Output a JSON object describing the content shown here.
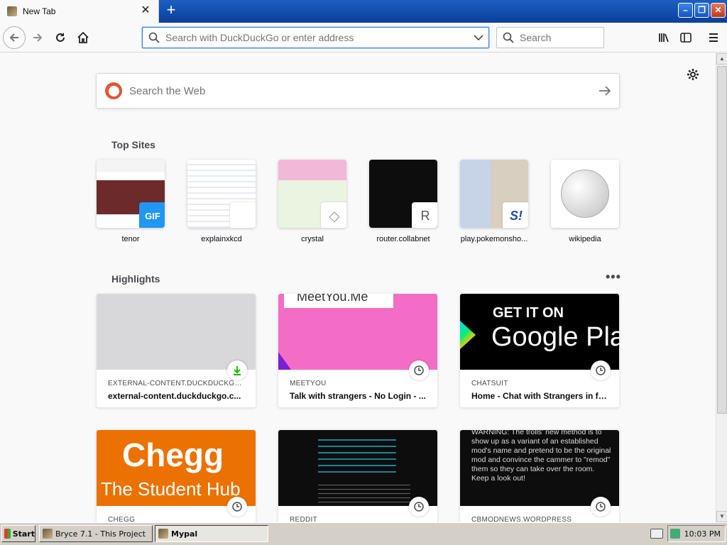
{
  "tab": {
    "title": "New Tab",
    "close": "✕"
  },
  "newtab": "+",
  "window": {
    "min": "–",
    "max": "❐",
    "close": "✕"
  },
  "urlbar": {
    "placeholder": "Search with DuckDuckGo or enter address"
  },
  "searchbar": {
    "placeholder": "Search"
  },
  "websearch": {
    "placeholder": "Search the Web"
  },
  "topsites": {
    "title": "Top Sites",
    "items": [
      {
        "label": "tenor",
        "badge": "GIF"
      },
      {
        "label": "explainxkcd",
        "badge": ""
      },
      {
        "label": "crystal",
        "badge": "◇"
      },
      {
        "label": "router.collabnet",
        "badge": "R"
      },
      {
        "label": "play.pokemonsho...",
        "badge": "S!"
      },
      {
        "label": "wikipedia",
        "badge": ""
      }
    ]
  },
  "highlights": {
    "title": "Highlights",
    "menu": "•••",
    "cards": [
      {
        "context": "EXTERNAL-CONTENT.DUCKDUCKGO — 3...",
        "title": "external-content.duckduckgo.c...",
        "icon": "download-icon"
      },
      {
        "context": "MEETYOU",
        "title": "Talk with strangers - No Login - ...",
        "icon": "clock-icon",
        "img_text": "MeetYou.Me"
      },
      {
        "context": "CHATSUIT",
        "title": "Home - Chat with Strangers in fr...",
        "icon": "clock-icon",
        "img_text_1": "GET IT ON",
        "img_text_2": "Google Pla"
      },
      {
        "context": "CHEGG",
        "title": "",
        "icon": "clock-icon",
        "img_text_1": "Chegg",
        "img_text_2": "The Student Hub"
      },
      {
        "context": "REDDIT",
        "title": "",
        "icon": "clock-icon"
      },
      {
        "context": "CBMODNEWS.WORDPRESS",
        "title": "",
        "icon": "clock-icon",
        "img_text": "WARNING: The trolls' new method is to show up as a variant of an established mod's name and pretend to be the original mod and convince the cammer to \"remod\" them so they can take over the room. Keep a look out!"
      }
    ]
  },
  "taskbar": {
    "start": "Start",
    "tasks": [
      "Bryce 7.1 - This Project",
      "Mypal"
    ],
    "clock": "10:03 PM"
  },
  "colors": {
    "accent": "#0a84ff",
    "chegg": "#eb7100",
    "meetyou": "#f36dc6",
    "ddg": "#de5833"
  }
}
